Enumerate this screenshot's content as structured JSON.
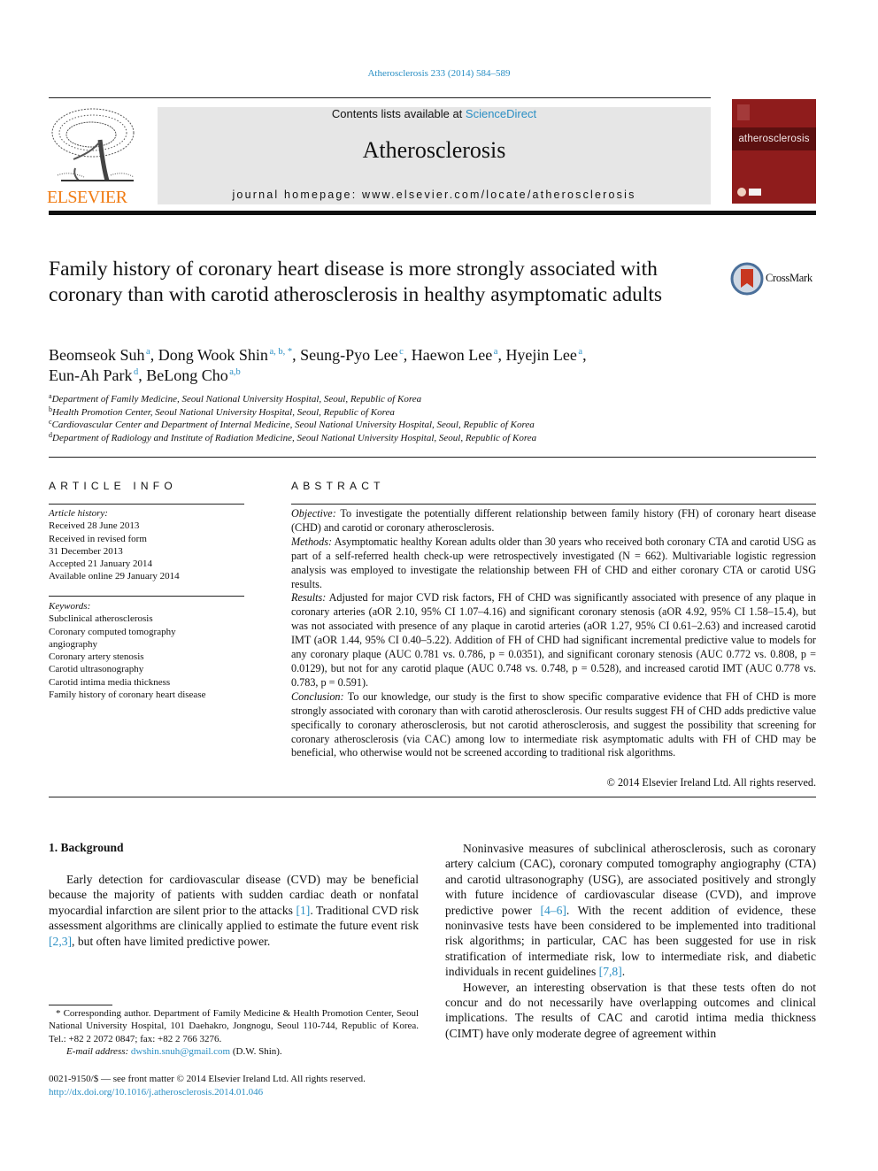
{
  "journal_citation": "Atherosclerosis 233 (2014) 584–589",
  "header": {
    "contents_prefix": "Contents lists available at ",
    "contents_link": "ScienceDirect",
    "journal_name": "Atherosclerosis",
    "homepage": "journal homepage: www.elsevier.com/locate/atherosclerosis",
    "publisher_logo": "ELSEVIER",
    "cover_title": "atherosclerosis"
  },
  "crossmark_label": "CrossMark",
  "article": {
    "title": "Family history of coronary heart disease is more strongly associated with coronary than with carotid atherosclerosis in healthy asymptomatic adults",
    "authors": [
      {
        "name": "Beomseok Suh",
        "sup": "a",
        "sep": ", "
      },
      {
        "name": "Dong Wook Shin",
        "sup": "a, b, *",
        "sep": ", "
      },
      {
        "name": "Seung-Pyo Lee",
        "sup": "c",
        "sep": ", "
      },
      {
        "name": "Haewon Lee",
        "sup": "a",
        "sep": ", "
      },
      {
        "name": "Hyejin Lee",
        "sup": "a",
        "sep": ","
      },
      {
        "name": "Eun-Ah Park",
        "sup": "d",
        "sep": ", "
      },
      {
        "name": "BeLong Cho",
        "sup": "a,b",
        "sep": ""
      }
    ],
    "affiliations": [
      {
        "key": "a",
        "text": "Department of Family Medicine, Seoul National University Hospital, Seoul, Republic of Korea"
      },
      {
        "key": "b",
        "text": "Health Promotion Center, Seoul National University Hospital, Seoul, Republic of Korea"
      },
      {
        "key": "c",
        "text": "Cardiovascular Center and Department of Internal Medicine, Seoul National University Hospital, Seoul, Republic of Korea"
      },
      {
        "key": "d",
        "text": "Department of Radiology and Institute of Radiation Medicine, Seoul National University Hospital, Seoul, Republic of Korea"
      }
    ]
  },
  "article_info": {
    "heading": "ARTICLE INFO",
    "history_label": "Article history:",
    "history": [
      "Received 28 June 2013",
      "Received in revised form",
      "31 December 2013",
      "Accepted 21 January 2014",
      "Available online 29 January 2014"
    ],
    "keywords_label": "Keywords:",
    "keywords": [
      "Subclinical atherosclerosis",
      "Coronary computed tomography",
      "angiography",
      "Coronary artery stenosis",
      "Carotid ultrasonography",
      "Carotid intima media thickness",
      "Family history of coronary heart disease"
    ]
  },
  "abstract": {
    "heading": "ABSTRACT",
    "objective_label": "Objective:",
    "objective": " To investigate the potentially different relationship between family history (FH) of coronary heart disease (CHD) and carotid or coronary atherosclerosis.",
    "methods_label": "Methods:",
    "methods": " Asymptomatic healthy Korean adults older than 30 years who received both coronary CTA and carotid USG as part of a self-referred health check-up were retrospectively investigated (N = 662). Multivariable logistic regression analysis was employed to investigate the relationship between FH of CHD and either coronary CTA or carotid USG results.",
    "results_label": "Results:",
    "results": " Adjusted for major CVD risk factors, FH of CHD was significantly associated with presence of any plaque in coronary arteries (aOR 2.10, 95% CI 1.07–4.16) and significant coronary stenosis (aOR 4.92, 95% CI 1.58–15.4), but was not associated with presence of any plaque in carotid arteries (aOR 1.27, 95% CI 0.61–2.63) and increased carotid IMT (aOR 1.44, 95% CI 0.40–5.22). Addition of FH of CHD had significant incremental predictive value to models for any coronary plaque (AUC 0.781 vs. 0.786, p = 0.0351), and significant coronary stenosis (AUC 0.772 vs. 0.808, p = 0.0129), but not for any carotid plaque (AUC 0.748 vs. 0.748, p = 0.528), and increased carotid IMT (AUC 0.778 vs. 0.783, p = 0.591).",
    "conclusion_label": "Conclusion:",
    "conclusion": " To our knowledge, our study is the first to show specific comparative evidence that FH of CHD is more strongly associated with coronary than with carotid atherosclerosis. Our results suggest FH of CHD adds predictive value specifically to coronary atherosclerosis, but not carotid atherosclerosis, and suggest the possibility that screening for coronary atherosclerosis (via CAC) among low to intermediate risk asymptomatic adults with FH of CHD may be beneficial, who otherwise would not be screened according to traditional risk algorithms.",
    "copyright": "© 2014 Elsevier Ireland Ltd. All rights reserved."
  },
  "body": {
    "section_heading": "1.  Background",
    "left_para": {
      "t1": "Early detection for cardiovascular disease (CVD) may be beneficial because the majority of patients with sudden cardiac death or nonfatal myocardial infarction are silent prior to the attacks ",
      "r1": "[1]",
      "t2": ". Traditional CVD risk assessment algorithms are clinically applied to estimate the future event risk ",
      "r2": "[2,3]",
      "t3": ", but often have limited predictive power."
    },
    "right_para1": {
      "t1": "Noninvasive measures of subclinical atherosclerosis, such as coronary artery calcium (CAC), coronary computed tomography angiography (CTA) and carotid ultrasonography (USG), are associated positively and strongly with future incidence of cardiovascular disease (CVD), and improve predictive power ",
      "r1": "[4–6]",
      "t2": ". With the recent addition of evidence, these noninvasive tests have been considered to be implemented into traditional risk algorithms; in particular, CAC has been suggested for use in risk stratification of intermediate risk, low to intermediate risk, and diabetic individuals in recent guidelines ",
      "r2": "[7,8]",
      "t3": "."
    },
    "right_para2": "However, an interesting observation is that these tests often do not concur and do not necessarily have overlapping outcomes and clinical implications. The results of CAC and carotid intima media thickness (CIMT) have only moderate degree of agreement within"
  },
  "footnote": {
    "corresponding": "* Corresponding author. Department of Family Medicine & Health Promotion Center, Seoul National University Hospital, 101 Daehakro, Jongnogu, Seoul 110-744, Republic of Korea. Tel.: +82 2 2072 0847; fax: +82 2 766 3276.",
    "email_label": "E-mail address:",
    "email": "dwshin.snuh@gmail.com",
    "email_suffix": " (D.W. Shin)."
  },
  "issn_line": "0021-9150/$ — see front matter © 2014 Elsevier Ireland Ltd. All rights reserved.",
  "doi": "http://dx.doi.org/10.1016/j.atherosclerosis.2014.01.046"
}
